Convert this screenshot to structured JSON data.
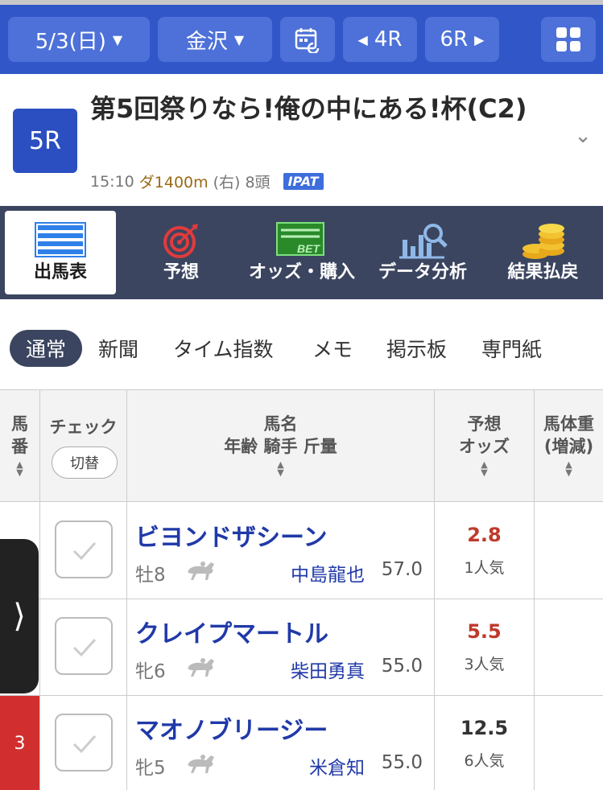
{
  "nav": {
    "date": "5/3(日)",
    "venue": "金沢",
    "prev_race": "4R",
    "next_race": "6R"
  },
  "race": {
    "badge": "5R",
    "title": "第5回祭りなら!俺の中にある!杯(C2)",
    "time": "15:10",
    "distance": "ダ1400m",
    "direction": "(右)",
    "field_size": "8頭",
    "ipat": "IPAT"
  },
  "function_tabs": [
    {
      "label": "出馬表",
      "icon": "race-card-icon",
      "active": true
    },
    {
      "label": "予想",
      "icon": "target-icon",
      "active": false
    },
    {
      "label": "オッズ・購入",
      "icon": "bet-icon",
      "active": false
    },
    {
      "label": "データ分析",
      "icon": "chart-search-icon",
      "active": false
    },
    {
      "label": "結果払戻",
      "icon": "coins-icon",
      "active": false
    }
  ],
  "sub_tabs": [
    {
      "label": "通常",
      "active": true
    },
    {
      "label": "新聞",
      "active": false
    },
    {
      "label": "タイム指数",
      "active": false
    },
    {
      "label": "メモ",
      "active": false
    },
    {
      "label": "掲示板",
      "active": false
    },
    {
      "label": "専門紙",
      "active": false
    }
  ],
  "table": {
    "headers": {
      "num_line1": "馬",
      "num_line2": "番",
      "check": "チェック",
      "switch": "切替",
      "name_line1": "馬名",
      "name_line2": "年齢 騎手 斤量",
      "odds_line1": "予想",
      "odds_line2": "オッズ",
      "weight_line1": "馬体重",
      "weight_line2": "(増減)"
    },
    "rows": [
      {
        "number": "",
        "name": "ビヨンドザシーン",
        "sex_age": "牡8",
        "jockey": "中島龍也",
        "kinryo": "57.0",
        "odds": "2.8",
        "popularity": "1人気",
        "odds_color": "#c0392b"
      },
      {
        "number": "",
        "name": "クレイプマートル",
        "sex_age": "牝6",
        "jockey": "柴田勇真",
        "kinryo": "55.0",
        "odds": "5.5",
        "popularity": "3人気",
        "odds_color": "#c0392b"
      },
      {
        "number": "3",
        "name": "マオノブリージー",
        "sex_age": "牝5",
        "jockey": "米倉知",
        "kinryo": "55.0",
        "odds": "12.5",
        "popularity": "6人気",
        "odds_color": "#333333"
      }
    ]
  },
  "colors": {
    "nav_bg": "#3156c8",
    "tab_bg": "#3b4560",
    "horse_name": "#2039a8",
    "number_3": "#d12f2f"
  }
}
